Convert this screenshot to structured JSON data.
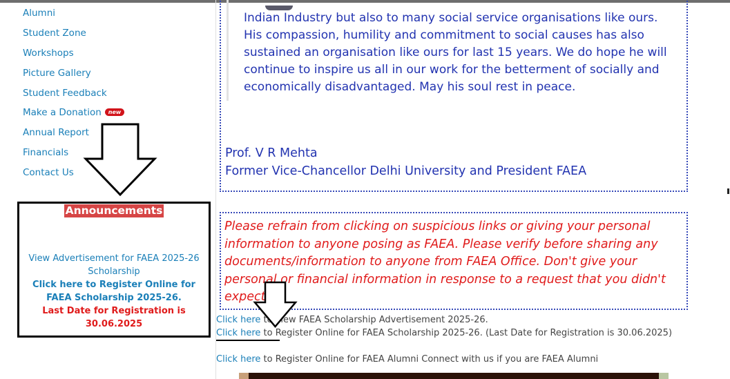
{
  "sidebar": {
    "items": [
      {
        "label": "Alumni"
      },
      {
        "label": "Student Zone"
      },
      {
        "label": "Workshops"
      },
      {
        "label": "Picture Gallery"
      },
      {
        "label": "Student Feedback"
      },
      {
        "label": "Make a Donation",
        "badge": "new"
      },
      {
        "label": "Annual Report"
      },
      {
        "label": "Financials"
      },
      {
        "label": "Contact Us"
      }
    ]
  },
  "announcements": {
    "title": "Announcements",
    "advert_link": "View Advertisement for FAEA 2025-26 Scholarship",
    "register_link": "Click here to Register Online for FAEA Scholarship 2025-26.",
    "deadline": "Last Date for Registration is 30.06.2025"
  },
  "tribute": {
    "text": "Indian Industry but also to many social service organisations like ours. His compassion, humility and commitment to social causes has also sustained an organisation like ours for last 15 years. We do hope he will continue to inspire us all in our work for the betterment of socially and economically disadvantaged. May his soul rest in peace.",
    "signature_name": "Prof. V R Mehta",
    "signature_title": "Former Vice-Chancellor Delhi University and President FAEA"
  },
  "warning": {
    "text": "Please refrain from clicking on suspicious links or giving your personal information to anyone posing as FAEA. Please verify before sharing any documents/information to anyone from FAEA Office. Don't give your personal or financial information in response to a request that you didn't expect."
  },
  "links": {
    "advert": {
      "link_text": "Click here",
      "rest": " to view FAEA Scholarship Advertisement 2025-26."
    },
    "register": {
      "link_text": "Click here",
      "rest": " to Register Online for FAEA Scholarship 2025-26. (Last Date for Registration is 30.06.2025)"
    },
    "alumni": {
      "link_text": "Click here",
      "rest": " to Register Online for FAEA Alumni Connect with us if you are FAEA Alumni"
    }
  },
  "colors": {
    "link": "#1a7fb8",
    "tribute_text": "#2233b0",
    "warning_text": "#e01b1b",
    "announcement_title_bg": "#d64545"
  },
  "icons": {
    "annotation_arrow": "down-arrow-icon"
  }
}
